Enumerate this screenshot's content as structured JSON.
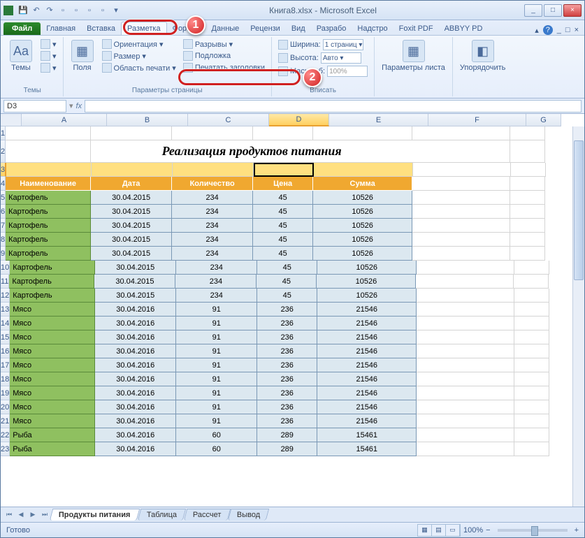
{
  "window": {
    "title": "Книга8.xlsx - Microsoft Excel",
    "min": "_",
    "max": "□",
    "close": "×",
    "doc_min": "_",
    "doc_max": "□",
    "doc_close": "×"
  },
  "tabs": {
    "file": "Файл",
    "list": [
      "Главная",
      "Вставка",
      "Разметка",
      "Формул",
      "Данные",
      "Рецензи",
      "Вид",
      "Разрабо",
      "Надстро",
      "Foxit PDF",
      "ABBYY PD"
    ],
    "active_index": 2,
    "help": "?"
  },
  "ribbon": {
    "themes": {
      "label": "Темы",
      "btn": "Темы"
    },
    "pagesetup": {
      "label": "Параметры страницы",
      "margins": "Поля",
      "orient": "Ориентация ▾",
      "size": "Размер ▾",
      "area": "Область печати ▾",
      "breaks": "Разрывы ▾",
      "bg": "Подложка",
      "titles": "Печатать заголовки"
    },
    "scale": {
      "label": "Вписать",
      "width_lbl": "Ширина:",
      "width_val": "1 страниц ▾",
      "height_lbl": "Высота:",
      "height_val": "Авто ▾",
      "scale_lbl": "Масштаб:",
      "scale_val": "100%"
    },
    "sheet": {
      "label": "",
      "btn": "Параметры листа"
    },
    "arrange": {
      "label": "",
      "btn": "Упорядочить"
    }
  },
  "namebox": "D3",
  "fx": "fx",
  "cols": [
    "A",
    "B",
    "C",
    "D",
    "E",
    "F",
    "G"
  ],
  "selcol": "D",
  "selrow": 3,
  "title_cell": "Реализация продуктов питания",
  "headers": [
    "Наименование",
    "Дата",
    "Количество",
    "Цена",
    "Сумма"
  ],
  "rows": [
    {
      "n": 5,
      "name": "Картофель",
      "date": "30.04.2015",
      "qty": "234",
      "price": "45",
      "sum": "10526"
    },
    {
      "n": 6,
      "name": "Картофель",
      "date": "30.04.2015",
      "qty": "234",
      "price": "45",
      "sum": "10526"
    },
    {
      "n": 7,
      "name": "Картофель",
      "date": "30.04.2015",
      "qty": "234",
      "price": "45",
      "sum": "10526"
    },
    {
      "n": 8,
      "name": "Картофель",
      "date": "30.04.2015",
      "qty": "234",
      "price": "45",
      "sum": "10526"
    },
    {
      "n": 9,
      "name": "Картофель",
      "date": "30.04.2015",
      "qty": "234",
      "price": "45",
      "sum": "10526"
    },
    {
      "n": 10,
      "name": "Картофель",
      "date": "30.04.2015",
      "qty": "234",
      "price": "45",
      "sum": "10526"
    },
    {
      "n": 11,
      "name": "Картофель",
      "date": "30.04.2015",
      "qty": "234",
      "price": "45",
      "sum": "10526"
    },
    {
      "n": 12,
      "name": "Картофель",
      "date": "30.04.2015",
      "qty": "234",
      "price": "45",
      "sum": "10526"
    },
    {
      "n": 13,
      "name": "Мясо",
      "date": "30.04.2016",
      "qty": "91",
      "price": "236",
      "sum": "21546"
    },
    {
      "n": 14,
      "name": "Мясо",
      "date": "30.04.2016",
      "qty": "91",
      "price": "236",
      "sum": "21546"
    },
    {
      "n": 15,
      "name": "Мясо",
      "date": "30.04.2016",
      "qty": "91",
      "price": "236",
      "sum": "21546"
    },
    {
      "n": 16,
      "name": "Мясо",
      "date": "30.04.2016",
      "qty": "91",
      "price": "236",
      "sum": "21546"
    },
    {
      "n": 17,
      "name": "Мясо",
      "date": "30.04.2016",
      "qty": "91",
      "price": "236",
      "sum": "21546"
    },
    {
      "n": 18,
      "name": "Мясо",
      "date": "30.04.2016",
      "qty": "91",
      "price": "236",
      "sum": "21546"
    },
    {
      "n": 19,
      "name": "Мясо",
      "date": "30.04.2016",
      "qty": "91",
      "price": "236",
      "sum": "21546"
    },
    {
      "n": 20,
      "name": "Мясо",
      "date": "30.04.2016",
      "qty": "91",
      "price": "236",
      "sum": "21546"
    },
    {
      "n": 21,
      "name": "Мясо",
      "date": "30.04.2016",
      "qty": "91",
      "price": "236",
      "sum": "21546"
    },
    {
      "n": 22,
      "name": "Рыба",
      "date": "30.04.2016",
      "qty": "60",
      "price": "289",
      "sum": "15461"
    },
    {
      "n": 23,
      "name": "Рыба",
      "date": "30.04.2016",
      "qty": "60",
      "price": "289",
      "sum": "15461"
    }
  ],
  "sheets": {
    "active": "Продукты питания",
    "others": [
      "Таблица",
      "Рассчет",
      "Вывод"
    ]
  },
  "status": {
    "ready": "Готово",
    "zoom": "100%",
    "minus": "−",
    "plus": "+"
  },
  "callouts": {
    "c1": "1",
    "c2": "2"
  }
}
